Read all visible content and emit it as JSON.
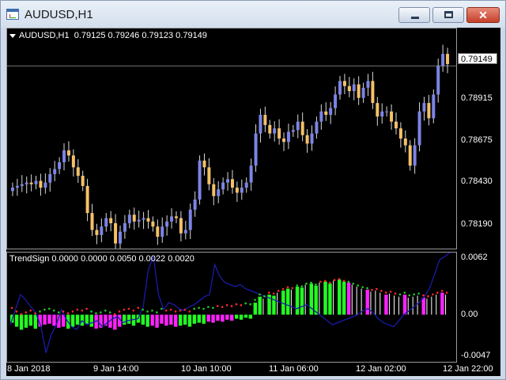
{
  "window": {
    "title": "AUDUSD,H1",
    "icon": "chart-window-icon"
  },
  "main_info": {
    "symbol": "AUDUSD,H1",
    "ohlc": "0.79125 0.79246 0.79123 0.79149"
  },
  "indicator_info": {
    "text": "TrendSign 0.0000 0.0000 0.0050 0.0022 0.0020"
  },
  "price_axis": {
    "current": "0.79149",
    "levels": [
      "0.78915",
      "0.78675",
      "0.78430",
      "0.78190"
    ]
  },
  "indicator_axis": {
    "levels": [
      "0.0062",
      "0.00",
      "-0.0047"
    ]
  },
  "time_axis": {
    "labels": [
      "8 Jan 2018",
      "9 Jan 14:00",
      "10 Jan 10:00",
      "11 Jan 06:00",
      "12 Jan 02:00",
      "12 Jan 22:00"
    ]
  },
  "colors": {
    "bull_candle": "#7c84e6",
    "bear_candle": "#f4c168",
    "histogram_up": "#22ff22",
    "histogram_down": "#ff22ff",
    "histogram_flat": "#ffffff",
    "signal_line": "#1a1aaa",
    "dots_red": "#ff2a2a",
    "dots_green": "#22cc22"
  },
  "chart_data": [
    {
      "type": "candlestick",
      "x": [
        "8 Jan 2018",
        "9 Jan 14:00",
        "10 Jan 10:00",
        "11 Jan 06:00",
        "12 Jan 02:00",
        "12 Jan 22:00"
      ],
      "ylim": [
        0.7807,
        0.7937
      ],
      "close_path": [
        0.7843,
        0.7844,
        0.7845,
        0.7846,
        0.7845,
        0.7847,
        0.7843,
        0.7846,
        0.7851,
        0.7854,
        0.7858,
        0.7865,
        0.7862,
        0.7855,
        0.785,
        0.7844,
        0.7828,
        0.7818,
        0.7815,
        0.782,
        0.7825,
        0.7822,
        0.781,
        0.7817,
        0.7822,
        0.7827,
        0.7823,
        0.7824,
        0.7825,
        0.7823,
        0.782,
        0.7814,
        0.782,
        0.7823,
        0.7826,
        0.7825,
        0.7816,
        0.7818,
        0.783,
        0.7836,
        0.7859,
        0.7855,
        0.7845,
        0.7838,
        0.7842,
        0.7846,
        0.7848,
        0.7843,
        0.784,
        0.7843,
        0.7846,
        0.7856,
        0.7875,
        0.7886,
        0.788,
        0.7875,
        0.7878,
        0.7872,
        0.787,
        0.7876,
        0.7877,
        0.7882,
        0.7874,
        0.7869,
        0.7875,
        0.7882,
        0.7888,
        0.7886,
        0.789,
        0.7898,
        0.7906,
        0.7903,
        0.79,
        0.7904,
        0.7896,
        0.7902,
        0.7906,
        0.7893,
        0.7885,
        0.7888,
        0.7888,
        0.7882,
        0.7878,
        0.7872,
        0.7868,
        0.7856,
        0.7868,
        0.7888,
        0.7893,
        0.7884,
        0.7898,
        0.7915,
        0.7922,
        0.7916
      ]
    },
    {
      "type": "bar",
      "series": [
        {
          "name": "TrendSign",
          "values": [
            0.0,
            0.0,
            0.005,
            0.0022,
            0.002
          ]
        }
      ],
      "ylim": [
        -0.0047,
        0.0062
      ],
      "hist_path": [
        -0.0008,
        -0.0012,
        -0.0015,
        -0.0013,
        -0.0011,
        -0.0014,
        -0.0012,
        -0.001,
        -0.0009,
        -0.0011,
        -0.0013,
        -0.0012,
        -0.0014,
        -0.0012,
        -0.001,
        -0.0011,
        -0.0009,
        -0.0012,
        -0.0014,
        -0.0013,
        -0.0011,
        -0.0013,
        -0.0015,
        -0.0012,
        -0.001,
        -0.0009,
        -0.0011,
        -0.0008,
        -0.001,
        -0.0012,
        -0.0011,
        -0.0013,
        -0.0009,
        -0.0011,
        -0.001,
        -0.0012,
        -0.0011,
        -0.001,
        -0.0012,
        -0.0009,
        -0.0008,
        -0.0009,
        -0.0007,
        -0.0008,
        -0.0006,
        -0.0007,
        -0.0005,
        -0.0006,
        -0.0004,
        -0.0005,
        -0.0003,
        -0.0004,
        0.0012,
        0.0018,
        0.0016,
        0.002,
        0.0019,
        0.0022,
        0.0024,
        0.0026,
        0.0025,
        0.0028,
        0.0027,
        0.003,
        0.0031,
        0.0029,
        0.0032,
        0.0033,
        0.0031,
        0.0034,
        0.0035,
        0.0033,
        0.0032,
        0.003,
        0.0028,
        0.0026,
        0.0025,
        0.0023,
        0.0024,
        0.0022,
        0.002,
        0.0021,
        0.0019,
        0.0018,
        0.002,
        0.0017,
        0.0018,
        0.0019,
        0.0017,
        0.0016,
        0.0018,
        0.002,
        0.0022,
        0.002
      ],
      "line_path": [
        -0.001,
        0.0005,
        0.002,
        0.0015,
        0.0008,
        0.0002,
        -0.0012,
        -0.0038,
        -0.002,
        -0.001,
        0.0005,
        -0.0005,
        -0.0012,
        -0.0015,
        -0.0006,
        -0.001,
        -0.0008,
        -0.0006,
        -0.0012,
        -0.0008,
        -0.0004,
        -0.0002,
        -0.0008,
        -0.0006,
        -0.0005,
        -0.0004,
        0.0008,
        0.0045,
        0.0058,
        0.002,
        0.0005,
        0.0012,
        0.001,
        0.0006,
        0.0004,
        0.0008,
        0.001,
        0.0014,
        0.0018,
        0.002,
        0.005,
        0.0038,
        0.0032,
        0.003,
        0.0028,
        0.003,
        0.0026,
        0.0024,
        0.0022,
        0.002,
        0.0018,
        0.0016,
        0.0014,
        0.0012,
        0.001,
        0.0008,
        0.0006,
        0.0008,
        0.001,
        0.0006,
        0.0002,
        -0.0002,
        -0.0006,
        -0.001,
        -0.0008,
        -0.0006,
        -0.0004,
        -0.0002,
        0.0,
        0.0004,
        0.0006,
        0.0002,
        -0.0004,
        -0.0008,
        -0.001,
        -0.0012,
        -0.0006,
        0.0,
        0.0004,
        0.0008,
        0.0012,
        0.0018,
        0.0026,
        0.004,
        0.0055,
        0.0058,
        0.0062
      ]
    }
  ]
}
